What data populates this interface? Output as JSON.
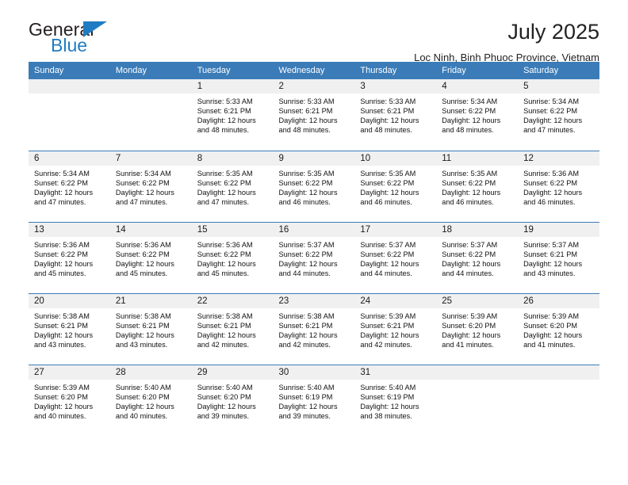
{
  "brand": {
    "name_part1": "General",
    "name_part2": "Blue",
    "triangle_color": "#1f7cc2"
  },
  "header": {
    "title": "July 2025",
    "subtitle": "Loc Ninh, Binh Phuoc Province, Vietnam"
  },
  "theme": {
    "header_blue": "#3b7cb8",
    "daynum_gray": "#f0f0f0",
    "text": "#111111"
  },
  "weekdays": [
    "Sunday",
    "Monday",
    "Tuesday",
    "Wednesday",
    "Thursday",
    "Friday",
    "Saturday"
  ],
  "labels": {
    "sunrise_prefix": "Sunrise:",
    "sunset_prefix": "Sunset:",
    "daylight_prefix": "Daylight:"
  },
  "weeks": [
    [
      {
        "day": "",
        "sunrise": "",
        "sunset": "",
        "daylight": "",
        "empty": true
      },
      {
        "day": "",
        "sunrise": "",
        "sunset": "",
        "daylight": "",
        "empty": true
      },
      {
        "day": "1",
        "sunrise": "Sunrise: 5:33 AM",
        "sunset": "Sunset: 6:21 PM",
        "daylight": "Daylight: 12 hours and 48 minutes."
      },
      {
        "day": "2",
        "sunrise": "Sunrise: 5:33 AM",
        "sunset": "Sunset: 6:21 PM",
        "daylight": "Daylight: 12 hours and 48 minutes."
      },
      {
        "day": "3",
        "sunrise": "Sunrise: 5:33 AM",
        "sunset": "Sunset: 6:21 PM",
        "daylight": "Daylight: 12 hours and 48 minutes."
      },
      {
        "day": "4",
        "sunrise": "Sunrise: 5:34 AM",
        "sunset": "Sunset: 6:22 PM",
        "daylight": "Daylight: 12 hours and 48 minutes."
      },
      {
        "day": "5",
        "sunrise": "Sunrise: 5:34 AM",
        "sunset": "Sunset: 6:22 PM",
        "daylight": "Daylight: 12 hours and 47 minutes."
      }
    ],
    [
      {
        "day": "6",
        "sunrise": "Sunrise: 5:34 AM",
        "sunset": "Sunset: 6:22 PM",
        "daylight": "Daylight: 12 hours and 47 minutes."
      },
      {
        "day": "7",
        "sunrise": "Sunrise: 5:34 AM",
        "sunset": "Sunset: 6:22 PM",
        "daylight": "Daylight: 12 hours and 47 minutes."
      },
      {
        "day": "8",
        "sunrise": "Sunrise: 5:35 AM",
        "sunset": "Sunset: 6:22 PM",
        "daylight": "Daylight: 12 hours and 47 minutes."
      },
      {
        "day": "9",
        "sunrise": "Sunrise: 5:35 AM",
        "sunset": "Sunset: 6:22 PM",
        "daylight": "Daylight: 12 hours and 46 minutes."
      },
      {
        "day": "10",
        "sunrise": "Sunrise: 5:35 AM",
        "sunset": "Sunset: 6:22 PM",
        "daylight": "Daylight: 12 hours and 46 minutes."
      },
      {
        "day": "11",
        "sunrise": "Sunrise: 5:35 AM",
        "sunset": "Sunset: 6:22 PM",
        "daylight": "Daylight: 12 hours and 46 minutes."
      },
      {
        "day": "12",
        "sunrise": "Sunrise: 5:36 AM",
        "sunset": "Sunset: 6:22 PM",
        "daylight": "Daylight: 12 hours and 46 minutes."
      }
    ],
    [
      {
        "day": "13",
        "sunrise": "Sunrise: 5:36 AM",
        "sunset": "Sunset: 6:22 PM",
        "daylight": "Daylight: 12 hours and 45 minutes."
      },
      {
        "day": "14",
        "sunrise": "Sunrise: 5:36 AM",
        "sunset": "Sunset: 6:22 PM",
        "daylight": "Daylight: 12 hours and 45 minutes."
      },
      {
        "day": "15",
        "sunrise": "Sunrise: 5:36 AM",
        "sunset": "Sunset: 6:22 PM",
        "daylight": "Daylight: 12 hours and 45 minutes."
      },
      {
        "day": "16",
        "sunrise": "Sunrise: 5:37 AM",
        "sunset": "Sunset: 6:22 PM",
        "daylight": "Daylight: 12 hours and 44 minutes."
      },
      {
        "day": "17",
        "sunrise": "Sunrise: 5:37 AM",
        "sunset": "Sunset: 6:22 PM",
        "daylight": "Daylight: 12 hours and 44 minutes."
      },
      {
        "day": "18",
        "sunrise": "Sunrise: 5:37 AM",
        "sunset": "Sunset: 6:22 PM",
        "daylight": "Daylight: 12 hours and 44 minutes."
      },
      {
        "day": "19",
        "sunrise": "Sunrise: 5:37 AM",
        "sunset": "Sunset: 6:21 PM",
        "daylight": "Daylight: 12 hours and 43 minutes."
      }
    ],
    [
      {
        "day": "20",
        "sunrise": "Sunrise: 5:38 AM",
        "sunset": "Sunset: 6:21 PM",
        "daylight": "Daylight: 12 hours and 43 minutes."
      },
      {
        "day": "21",
        "sunrise": "Sunrise: 5:38 AM",
        "sunset": "Sunset: 6:21 PM",
        "daylight": "Daylight: 12 hours and 43 minutes."
      },
      {
        "day": "22",
        "sunrise": "Sunrise: 5:38 AM",
        "sunset": "Sunset: 6:21 PM",
        "daylight": "Daylight: 12 hours and 42 minutes."
      },
      {
        "day": "23",
        "sunrise": "Sunrise: 5:38 AM",
        "sunset": "Sunset: 6:21 PM",
        "daylight": "Daylight: 12 hours and 42 minutes."
      },
      {
        "day": "24",
        "sunrise": "Sunrise: 5:39 AM",
        "sunset": "Sunset: 6:21 PM",
        "daylight": "Daylight: 12 hours and 42 minutes."
      },
      {
        "day": "25",
        "sunrise": "Sunrise: 5:39 AM",
        "sunset": "Sunset: 6:20 PM",
        "daylight": "Daylight: 12 hours and 41 minutes."
      },
      {
        "day": "26",
        "sunrise": "Sunrise: 5:39 AM",
        "sunset": "Sunset: 6:20 PM",
        "daylight": "Daylight: 12 hours and 41 minutes."
      }
    ],
    [
      {
        "day": "27",
        "sunrise": "Sunrise: 5:39 AM",
        "sunset": "Sunset: 6:20 PM",
        "daylight": "Daylight: 12 hours and 40 minutes."
      },
      {
        "day": "28",
        "sunrise": "Sunrise: 5:40 AM",
        "sunset": "Sunset: 6:20 PM",
        "daylight": "Daylight: 12 hours and 40 minutes."
      },
      {
        "day": "29",
        "sunrise": "Sunrise: 5:40 AM",
        "sunset": "Sunset: 6:20 PM",
        "daylight": "Daylight: 12 hours and 39 minutes."
      },
      {
        "day": "30",
        "sunrise": "Sunrise: 5:40 AM",
        "sunset": "Sunset: 6:19 PM",
        "daylight": "Daylight: 12 hours and 39 minutes."
      },
      {
        "day": "31",
        "sunrise": "Sunrise: 5:40 AM",
        "sunset": "Sunset: 6:19 PM",
        "daylight": "Daylight: 12 hours and 38 minutes."
      },
      {
        "day": "",
        "sunrise": "",
        "sunset": "",
        "daylight": "",
        "empty": true
      },
      {
        "day": "",
        "sunrise": "",
        "sunset": "",
        "daylight": "",
        "empty": true
      }
    ]
  ]
}
